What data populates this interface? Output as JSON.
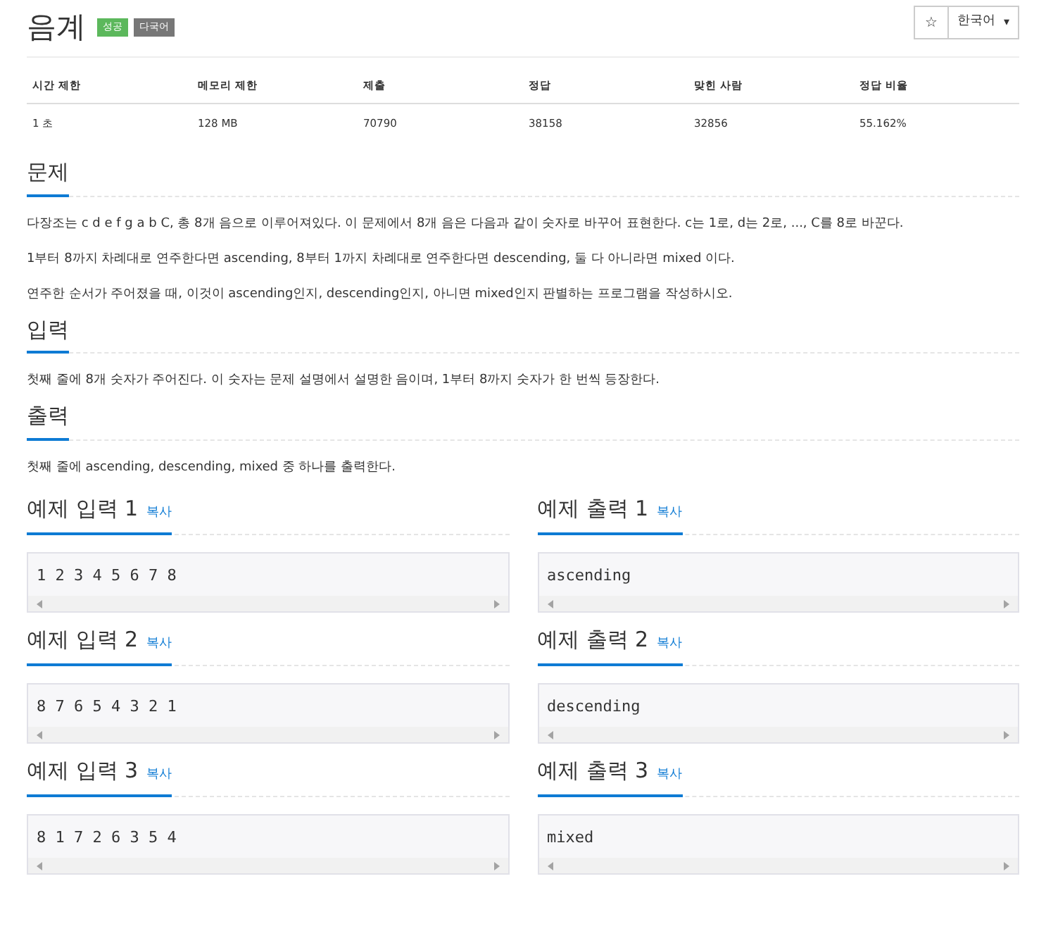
{
  "title": "음계",
  "badges": [
    {
      "label": "성공",
      "color": "#5cb85c"
    },
    {
      "label": "다국어",
      "color": "#777777"
    }
  ],
  "star": "☆",
  "language": {
    "label": "한국어",
    "caret": "▾"
  },
  "stats": {
    "columns": [
      "시간 제한",
      "메모리 제한",
      "제출",
      "정답",
      "맞힌 사람",
      "정답 비율"
    ],
    "values": [
      "1 초",
      "128 MB",
      "70790",
      "38158",
      "32856",
      "55.162%"
    ]
  },
  "sections": [
    {
      "heading": "문제",
      "paragraphs": [
        "다장조는 c d e f g a b C, 총 8개 음으로 이루어져있다. 이 문제에서 8개 음은 다음과 같이 숫자로 바꾸어 표현한다. c는 1로, d는 2로, ..., C를 8로 바꾼다.",
        "1부터 8까지 차례대로 연주한다면 ascending, 8부터 1까지 차례대로 연주한다면 descending, 둘 다 아니라면 mixed 이다.",
        "연주한 순서가 주어졌을 때, 이것이 ascending인지, descending인지, 아니면 mixed인지 판별하는 프로그램을 작성하시오."
      ]
    },
    {
      "heading": "입력",
      "paragraphs": [
        "첫째 줄에 8개 숫자가 주어진다. 이 숫자는 문제 설명에서 설명한 음이며, 1부터 8까지 숫자가 한 번씩 등장한다."
      ]
    },
    {
      "heading": "출력",
      "paragraphs": [
        "첫째 줄에 ascending, descending, mixed 중 하나를 출력한다."
      ]
    }
  ],
  "samples": [
    {
      "input_title": "예제 입력 1",
      "input_copy": "복사",
      "input": "1 2 3 4 5 6 7 8",
      "output_title": "예제 출력 1",
      "output_copy": "복사",
      "output": "ascending"
    },
    {
      "input_title": "예제 입력 2",
      "input_copy": "복사",
      "input": "8 7 6 5 4 3 2 1",
      "output_title": "예제 출력 2",
      "output_copy": "복사",
      "output": "descending"
    },
    {
      "input_title": "예제 입력 3",
      "input_copy": "복사",
      "input": "8 1 7 2 6 3 5 4",
      "output_title": "예제 출력 3",
      "output_copy": "복사",
      "output": "mixed"
    }
  ]
}
